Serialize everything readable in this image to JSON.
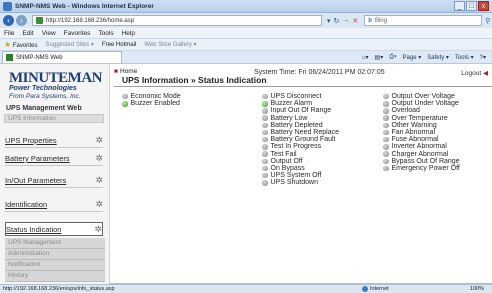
{
  "window": {
    "title": "SNMP-NMS Web - Windows Internet Explorer",
    "controls": [
      "_",
      "□",
      "x"
    ]
  },
  "address": {
    "url": "http://192.168.168.236/home.asp",
    "search_placeholder": "Bing"
  },
  "menu": [
    "File",
    "Edit",
    "View",
    "Favorites",
    "Tools",
    "Help"
  ],
  "favorites": {
    "label": "Favorites",
    "items": [
      "Suggested Sites ▾",
      "Free Hotmail",
      "Web Slice Gallery ▾"
    ]
  },
  "tab": {
    "label": "SNMP-NMS Web"
  },
  "commands": [
    "Page ▾",
    "Safety ▾",
    "Tools ▾"
  ],
  "logo": {
    "brand": "MINUTEMAN",
    "sub": "Power Technologies",
    "from": "From Para Systems, Inc."
  },
  "sidebar": {
    "heading": "UPS Management Web",
    "selected": "UPS Information",
    "links": [
      "UPS Properties",
      "Battery Parameters",
      "In/Out Parameters",
      "Identification",
      "Status Indication"
    ],
    "sections": [
      "UPS Management",
      "Administration",
      "Notification",
      "History"
    ]
  },
  "main": {
    "breadcrumb": "Home",
    "title": "UPS Information » Status Indication",
    "system_time": "System Time: Fri 06/24/2011 PM 02:07:05",
    "logout": "Logout"
  },
  "indicators": {
    "col1": [
      {
        "label": "Economic Mode",
        "state": "gray"
      },
      {
        "label": "Buzzer Enabled",
        "state": "green"
      }
    ],
    "col2": [
      {
        "label": "UPS Disconnect",
        "state": "gray"
      },
      {
        "label": "Buzzer Alarm",
        "state": "green"
      },
      {
        "label": "Input Out Of Range",
        "state": "gray"
      },
      {
        "label": "Battery Low",
        "state": "gray"
      },
      {
        "label": "Battery Depleted",
        "state": "gray"
      },
      {
        "label": "Battery Need Replace",
        "state": "gray"
      },
      {
        "label": "Battery Ground Fault",
        "state": "gray"
      },
      {
        "label": "Test In Progress",
        "state": "gray"
      },
      {
        "label": "Test Fail",
        "state": "gray"
      },
      {
        "label": "Output Off",
        "state": "gray"
      },
      {
        "label": "On Bypass",
        "state": "gray"
      },
      {
        "label": "UPS System Off",
        "state": "gray"
      },
      {
        "label": "UPS Shutdown",
        "state": "gray"
      }
    ],
    "col3": [
      {
        "label": "Output Over Voltage",
        "state": "gray"
      },
      {
        "label": "Output Under Voltage",
        "state": "gray"
      },
      {
        "label": "Overload",
        "state": "gray"
      },
      {
        "label": "Over Temperature",
        "state": "gray"
      },
      {
        "label": "Other Warning",
        "state": "gray"
      },
      {
        "label": "Fan Abnormal",
        "state": "gray"
      },
      {
        "label": "Fuse Abnormal",
        "state": "gray"
      },
      {
        "label": "Inverter Abnormal",
        "state": "gray"
      },
      {
        "label": "Charger Abnormal",
        "state": "gray"
      },
      {
        "label": "Bypass Out Of Range",
        "state": "gray"
      },
      {
        "label": "Emergency Power Off",
        "state": "gray"
      }
    ]
  },
  "statusbar": {
    "url": "http://192.168.168.236/en/ups/info_status.asp",
    "zone": "Internet",
    "zoom": "100%"
  }
}
